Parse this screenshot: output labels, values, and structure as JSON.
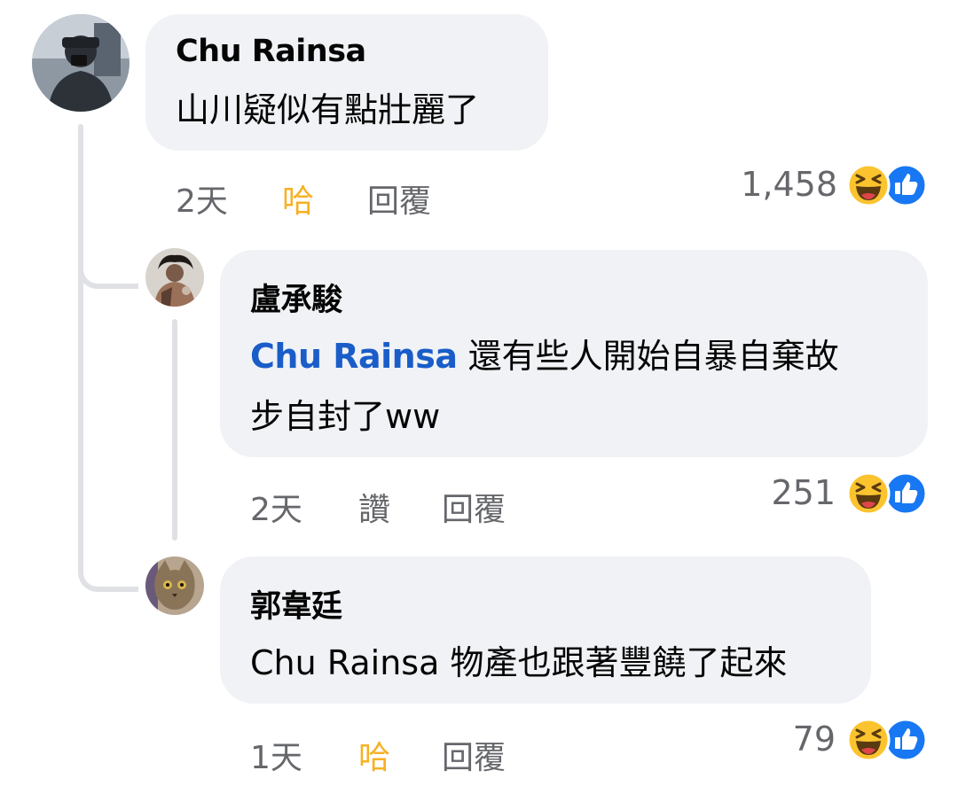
{
  "colors": {
    "bubble": "#f0f2f5",
    "mention": "#1a5dc9",
    "meta": "#65676b",
    "haha_action": "#f7b125",
    "like_blue": "#1877f2",
    "haha_yellow": "#fbc32e",
    "thread_line": "#dfe1e5"
  },
  "comments": [
    {
      "author": "Chu Rainsa",
      "text": "山川疑似有點壯麗了",
      "time": "2天",
      "reaction_action": "哈",
      "reply_label": "回覆",
      "reaction_count": "1,458",
      "reaction_icons": [
        "haha-icon",
        "like-icon"
      ]
    },
    {
      "author": "盧承駿",
      "mention": "Chu Rainsa",
      "text_line1": "還有些人開始自暴自棄故",
      "text_line2": "步自封了ww",
      "time": "2天",
      "reaction_action": "讚",
      "reply_label": "回覆",
      "reaction_count": "251",
      "reaction_icons": [
        "haha-icon",
        "like-icon"
      ]
    },
    {
      "author": "郭韋廷",
      "mention": "Chu Rainsa",
      "text": "物產也跟著豐饒了起來",
      "time": "1天",
      "reaction_action": "哈",
      "reply_label": "回覆",
      "reaction_count": "79",
      "reaction_icons": [
        "haha-icon",
        "like-icon"
      ]
    }
  ]
}
